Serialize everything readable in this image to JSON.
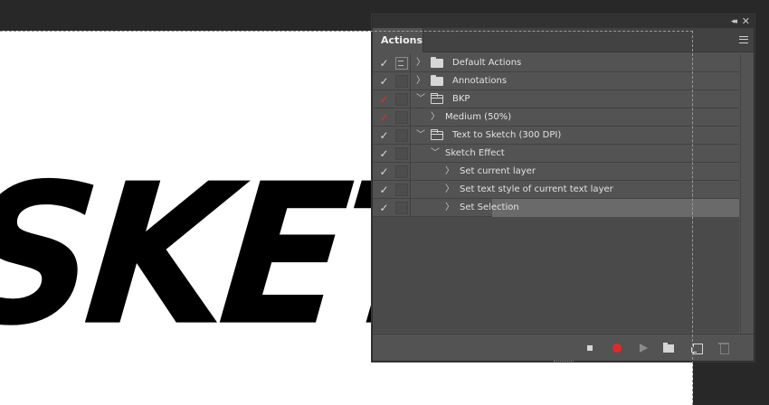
{
  "canvas": {
    "text": "SKETCH"
  },
  "panel": {
    "tab_label": "Actions",
    "collapse_glyph": "◂◂",
    "close_glyph": "✕"
  },
  "actions": [
    {
      "label": "Default Actions",
      "check": "✓",
      "check_color": "white",
      "dialog_icon": true,
      "chevron": "〉",
      "folder": "closed",
      "indent": 0
    },
    {
      "label": "Annotations",
      "check": "✓",
      "check_color": "white",
      "dialog_icon": false,
      "chevron": "〉",
      "folder": "closed",
      "indent": 0
    },
    {
      "label": "BKP",
      "check": "✓",
      "check_color": "red",
      "dialog_icon": false,
      "chevron": "﹀",
      "folder": "open",
      "indent": 0
    },
    {
      "label": "Medium (50%)",
      "check": "✓",
      "check_color": "red",
      "dialog_icon": false,
      "chevron": "〉",
      "folder": "none",
      "indent": 1
    },
    {
      "label": "Text to Sketch (300 DPI)",
      "check": "✓",
      "check_color": "white",
      "dialog_icon": false,
      "chevron": "﹀",
      "folder": "open",
      "indent": 0
    },
    {
      "label": "Sketch Effect",
      "check": "✓",
      "check_color": "white",
      "dialog_icon": false,
      "chevron": "﹀",
      "folder": "none",
      "indent": 1
    },
    {
      "label": "Set current layer",
      "check": "✓",
      "check_color": "white",
      "dialog_icon": false,
      "chevron": "〉",
      "folder": "none",
      "indent": 2
    },
    {
      "label": "Set text style of current text layer",
      "check": "✓",
      "check_color": "white",
      "dialog_icon": false,
      "chevron": "〉",
      "folder": "none",
      "indent": 2
    },
    {
      "label": "Set Selection",
      "check": "✓",
      "check_color": "white",
      "dialog_icon": false,
      "chevron": "〉",
      "folder": "none",
      "indent": 2,
      "selected": true
    }
  ],
  "colors": {
    "panel_bg": "#535353",
    "record_red": "#e02a2a",
    "check_red": "#e03030"
  }
}
